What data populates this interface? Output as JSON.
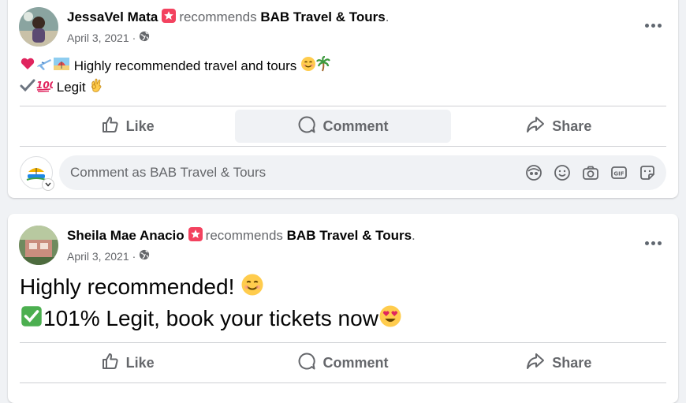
{
  "posts": [
    {
      "author": "JessaVel Mata",
      "recommends": "recommends",
      "page_name": "BAB Travel & Tours",
      "period": ".",
      "date": "April 3, 2021",
      "separator": "·",
      "line1_text": "Highly recommended travel and tours",
      "line2_text": "Legit",
      "line1_emojis": [
        "red-heart",
        "airplane",
        "beach",
        "smiling-face",
        "palm-tree"
      ],
      "line2_emojis": [
        "check-mark",
        "hundred-points",
        "ok-hand"
      ]
    },
    {
      "author": "Sheila Mae Anacio",
      "recommends": "recommends",
      "page_name": "BAB Travel & Tours",
      "period": ".",
      "date": "April 3, 2021",
      "separator": "·",
      "line1_text": "Highly recommended!",
      "line2_text": "101% Legit, book your tickets now",
      "line1_emojis": [
        "smiling-face"
      ],
      "line2_emojis": [
        "green-check-box",
        "heart-eyes"
      ]
    }
  ],
  "actions": {
    "like": "Like",
    "comment": "Comment",
    "share": "Share"
  },
  "comment_box": {
    "placeholder": "Comment as BAB Travel & Tours",
    "icons": [
      "avatar-sticker-icon",
      "emoji-icon",
      "camera-icon",
      "gif-icon",
      "sticker-icon"
    ]
  },
  "colors": {
    "background": "#f0f2f5",
    "card": "#ffffff",
    "secondary_text": "#65676b",
    "recommend_badge": "#f3425f"
  }
}
